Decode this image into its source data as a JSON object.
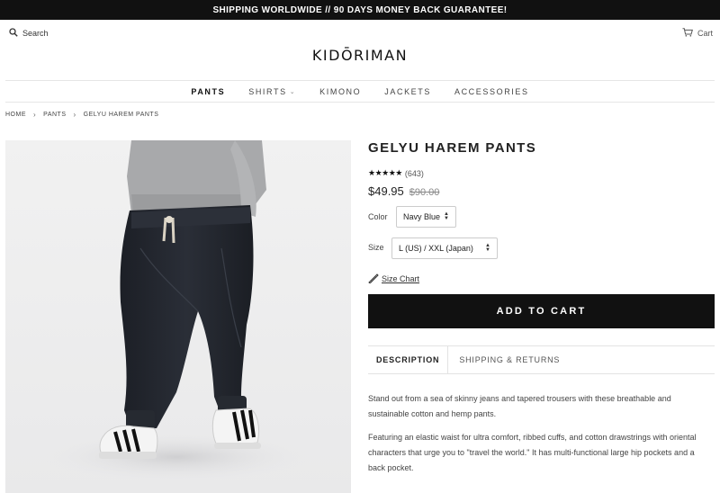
{
  "announcement": "SHIPPING WORLDWIDE // 90 DAYS MONEY BACK GUARANTEE!",
  "header": {
    "search_label": "Search",
    "cart_label": "Cart",
    "logo": "KIDŌRIMAN"
  },
  "nav": {
    "items": [
      {
        "label": "PANTS",
        "active": true
      },
      {
        "label": "SHIRTS",
        "dropdown": true
      },
      {
        "label": "KIMONO"
      },
      {
        "label": "JACKETS"
      },
      {
        "label": "ACCESSORIES"
      }
    ]
  },
  "breadcrumb": [
    "HOME",
    "PANTS",
    "GELYU HAREM PANTS"
  ],
  "product": {
    "title": "GELYU HAREM PANTS",
    "stars": "★★★★★",
    "review_count": "(643)",
    "price": "$49.95",
    "compare_price": "$90.00",
    "color_label": "Color",
    "color_value": "Navy Blue",
    "size_label": "Size",
    "size_value": "L (US) / XXL (Japan)",
    "size_chart": "Size Chart",
    "add_to_cart": "ADD TO CART",
    "pants_color": "#23262e"
  },
  "tabs": [
    {
      "label": "DESCRIPTION",
      "active": true
    },
    {
      "label": "SHIPPING & RETURNS"
    }
  ],
  "description": {
    "p1": "Stand out from a sea of skinny jeans and tapered trousers with these breathable and sustainable cotton and hemp pants.",
    "p2": "Featuring an elastic waist for ultra comfort, ribbed cuffs, and cotton drawstrings with oriental characters that urge you to \"travel the world.\" It has multi-functional large hip pockets and a back pocket."
  }
}
